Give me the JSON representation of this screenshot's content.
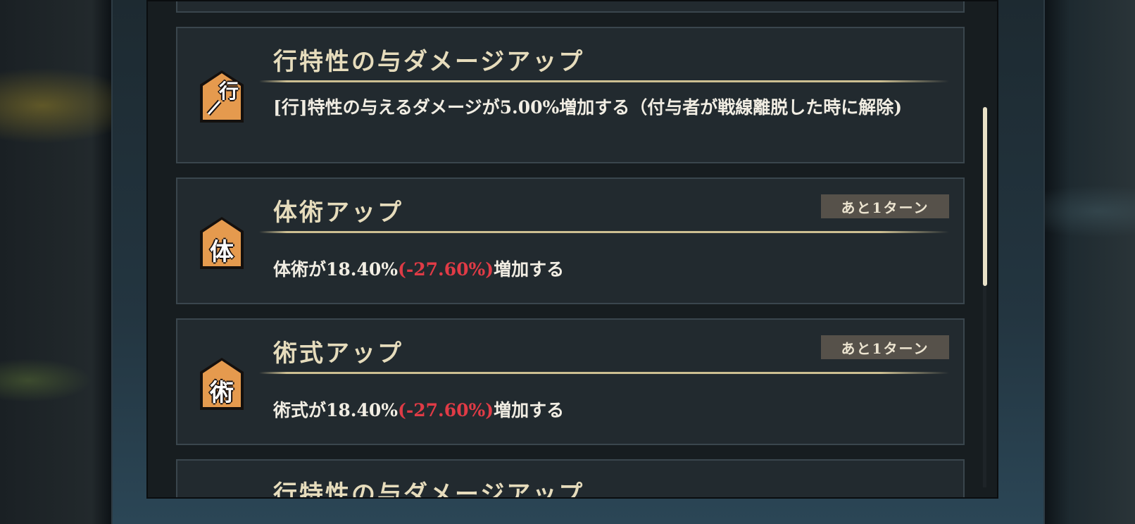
{
  "buffs": [
    {
      "title": "行特性の与ダメージアップ",
      "icon_char": "行",
      "icon": "sword-trait-icon",
      "desc_text": "[行]特性の与えるダメージが5.00%増加する（付与者が戦線離脱した時に解除)"
    },
    {
      "title": "体術アップ",
      "icon_char": "体",
      "icon": "taijutsu-icon",
      "turn_badge": "あと1ターン",
      "desc_prefix": "体術が18.40%",
      "desc_negative": "(-27.60%)",
      "desc_suffix": "増加する"
    },
    {
      "title": "術式アップ",
      "icon_char": "術",
      "icon": "jutsushiki-icon",
      "turn_badge": "あと1ターン",
      "desc_prefix": "術式が18.40%",
      "desc_negative": "(-27.60%)",
      "desc_suffix": "増加する"
    },
    {
      "title": "行特性の与ダメージアップ"
    }
  ],
  "colors": {
    "accent_gold": "#e6dcbc",
    "negative_red": "#e03b46",
    "icon_orange": "#e59a4e",
    "badge_bg": "#56514a"
  }
}
